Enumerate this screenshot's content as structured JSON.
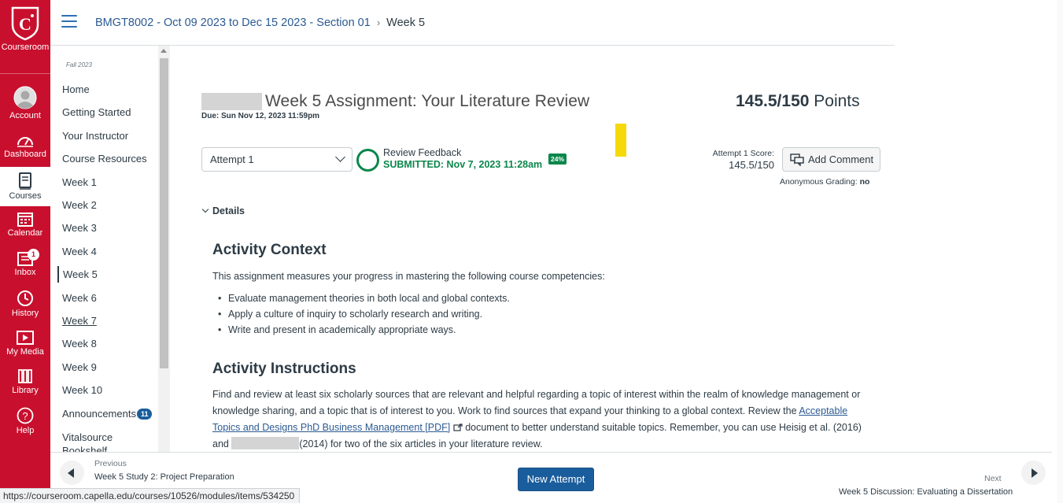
{
  "global_nav": {
    "logo_label": "Courseroom",
    "items": [
      {
        "label": "Account",
        "icon": "account-icon"
      },
      {
        "label": "Dashboard",
        "icon": "dashboard-icon"
      },
      {
        "label": "Courses",
        "icon": "courses-icon"
      },
      {
        "label": "Calendar",
        "icon": "calendar-icon"
      },
      {
        "label": "Inbox",
        "icon": "inbox-icon",
        "badge": "1"
      },
      {
        "label": "History",
        "icon": "history-icon"
      },
      {
        "label": "My Media",
        "icon": "media-icon"
      },
      {
        "label": "Library",
        "icon": "library-icon"
      },
      {
        "label": "Help",
        "icon": "help-icon"
      }
    ],
    "brand_color": "#c8102e"
  },
  "breadcrumb": {
    "course": "BMGT8002 - Oct 09 2023 to Dec 15 2023 - Section 01",
    "current": "Week 5"
  },
  "course_nav": {
    "term": "Fall 2023",
    "items": [
      "Home",
      "Getting Started",
      "Your Instructor",
      "Course Resources",
      "Week 1",
      "Week 2",
      "Week 3",
      "Week 4",
      "Week 5",
      "Week 6",
      "Week 7",
      "Week 8",
      "Week 9",
      "Week 10",
      "Announcements",
      "Vitalsource Bookshelf"
    ],
    "announcements_badge": "11"
  },
  "assignment": {
    "title": "Week 5 Assignment: Your Literature Review",
    "due": "Due: Sun Nov 12, 2023 11:59pm",
    "points_score": "145.5/150",
    "points_label": "Points",
    "attempt_select": "Attempt 1",
    "review_feedback": "Review Feedback",
    "submitted": "SUBMITTED: Nov 7, 2023 11:28am",
    "similarity_badge": "24%",
    "attempt_score_label": "Attempt 1 Score:",
    "attempt_score_value": "145.5/150",
    "add_comment": "Add Comment",
    "anonymous_label": "Anonymous Grading:",
    "anonymous_value": "no",
    "details_label": "Details"
  },
  "content": {
    "context_heading": "Activity Context",
    "context_intro": "This assignment measures your progress in mastering the following course competencies:",
    "competencies": [
      "Evaluate management theories in both local and global contexts.",
      "Apply a culture of inquiry to scholarly research and writing.",
      "Write and present in academically appropriate ways."
    ],
    "instructions_heading": "Activity Instructions",
    "instr_line1": "Find and review at least six scholarly sources that are relevant and helpful regarding a topic of interest within the realm of knowledge management or",
    "instr_line2a": "knowledge sharing, and a topic that is of interest to you. Work to find sources that expand your thinking to a global context. Review the ",
    "instr_link_part1": "Acceptable",
    "instr_link_part2": "Topics and Designs PhD Business Management [PDF]",
    "instr_line3b": " document to better understand suitable topics. Remember, you can use Heisig et al. (2016)",
    "instr_line4a": "and ",
    "instr_line4b": "(2014) for two of the six articles in your literature review."
  },
  "footer": {
    "previous_label": "Previous",
    "previous_title": "Week 5 Study 2: Project Preparation",
    "new_attempt": "New Attempt",
    "next_label": "Next",
    "next_title": "Week 5 Discussion: Evaluating a Dissertation"
  },
  "status_url": "https://courseroom.capella.edu/courses/10526/modules/items/534250"
}
